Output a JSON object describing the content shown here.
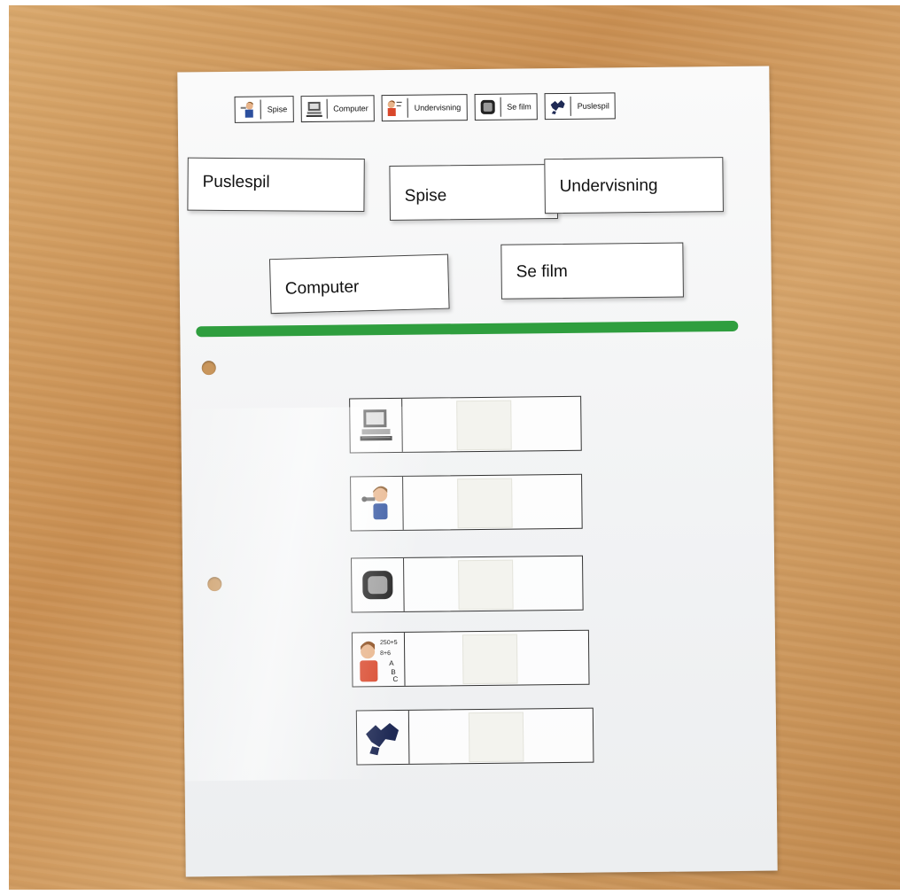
{
  "top_strip": {
    "cards": [
      {
        "label": "Spise",
        "icon": "eating-icon"
      },
      {
        "label": "Computer",
        "icon": "computer-icon"
      },
      {
        "label": "Undervisning",
        "icon": "teaching-icon"
      },
      {
        "label": "Se film",
        "icon": "tv-icon"
      },
      {
        "label": "Puslespil",
        "icon": "puzzle-icon"
      }
    ]
  },
  "word_cards": {
    "puslespil": "Puslespil",
    "spise": "Spise",
    "undervisning": "Undervisning",
    "computer": "Computer",
    "se_film": "Se film"
  },
  "schedule_slots": [
    {
      "icon": "computer-icon"
    },
    {
      "icon": "eating-icon"
    },
    {
      "icon": "tv-icon"
    },
    {
      "icon": "teaching-icon",
      "icon_text": "250+5 8+6 A B C"
    },
    {
      "icon": "puzzle-icon"
    }
  ],
  "colors": {
    "divider": "#2f9e3e",
    "table": "#c98f52",
    "sheet": "#f3f4f5"
  }
}
